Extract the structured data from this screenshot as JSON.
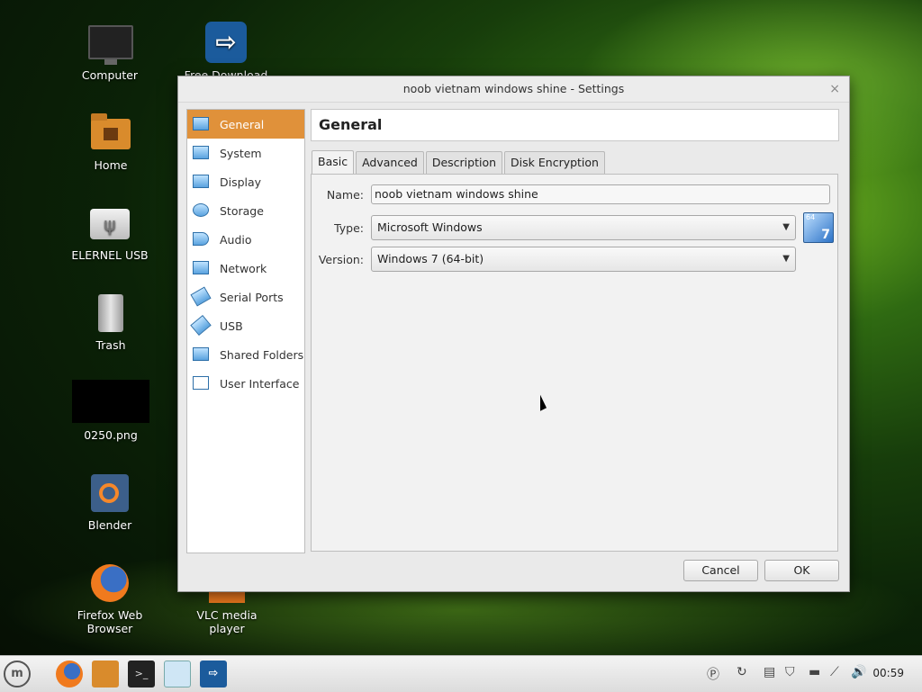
{
  "desktop": {
    "icons": [
      {
        "label": "Computer"
      },
      {
        "label": "Free Download"
      },
      {
        "label": "Home"
      },
      {
        "label": "ELERNEL USB"
      },
      {
        "label": "Trash"
      },
      {
        "label": "0250.png"
      },
      {
        "label": "Blender"
      },
      {
        "label": "Firefox Web Browser"
      },
      {
        "label": "VLC media player"
      }
    ]
  },
  "dialog": {
    "title": "noob vietnam windows shine - Settings",
    "close_glyph": "×",
    "sidebar": [
      {
        "label": "General",
        "icon": "general-icon"
      },
      {
        "label": "System",
        "icon": "system-icon"
      },
      {
        "label": "Display",
        "icon": "display-icon"
      },
      {
        "label": "Storage",
        "icon": "storage-icon"
      },
      {
        "label": "Audio",
        "icon": "audio-icon"
      },
      {
        "label": "Network",
        "icon": "network-icon"
      },
      {
        "label": "Serial Ports",
        "icon": "serial-ports-icon"
      },
      {
        "label": "USB",
        "icon": "usb-icon"
      },
      {
        "label": "Shared Folders",
        "icon": "shared-folders-icon"
      },
      {
        "label": "User Interface",
        "icon": "user-interface-icon"
      }
    ],
    "selected_section": "General",
    "header": "General",
    "tabs": [
      {
        "label": "Basic"
      },
      {
        "label": "Advanced"
      },
      {
        "label": "Description"
      },
      {
        "label": "Disk Encryption"
      }
    ],
    "active_tab": "Basic",
    "form": {
      "name_label": "Name:",
      "name_value": "noob vietnam windows shine",
      "type_label": "Type:",
      "type_value": "Microsoft Windows",
      "version_label": "Version:",
      "version_value": "Windows 7 (64-bit)",
      "os_badge_top": "64",
      "os_badge_num": "7"
    },
    "buttons": {
      "cancel": "Cancel",
      "ok": "OK"
    }
  },
  "taskbar": {
    "clock": "00:59",
    "accent": "#e0913a"
  }
}
